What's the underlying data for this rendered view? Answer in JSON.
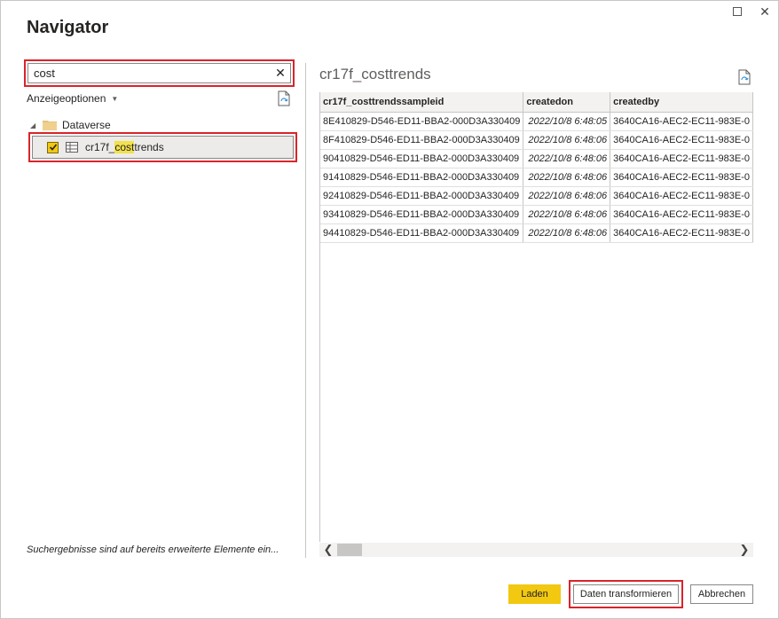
{
  "window": {
    "title": "Navigator",
    "maximize_icon": "maximize-icon",
    "close_icon": "close-icon",
    "close_glyph": "✕"
  },
  "search": {
    "value": "cost",
    "placeholder": "",
    "clear_glyph": "✕"
  },
  "options": {
    "label": "Anzeigeoptionen",
    "caret": "▼"
  },
  "tree": {
    "folder": {
      "label": "Dataverse",
      "expand_glyph": "◢"
    },
    "item": {
      "label_prefix": "cr17f_",
      "label_highlight": "cost",
      "label_suffix": "trends",
      "checked": true
    }
  },
  "left_footer": "Suchergebnisse sind auf bereits erweiterte Elemente ein...",
  "preview": {
    "title": "cr17f_costtrends",
    "columns": [
      "cr17f_costtrendssampleid",
      "createdon",
      "createdby"
    ],
    "rows": [
      [
        "8E410829-D546-ED11-BBA2-000D3A330409",
        "2022/10/8 6:48:05",
        "3640CA16-AEC2-EC11-983E-0"
      ],
      [
        "8F410829-D546-ED11-BBA2-000D3A330409",
        "2022/10/8 6:48:06",
        "3640CA16-AEC2-EC11-983E-0"
      ],
      [
        "90410829-D546-ED11-BBA2-000D3A330409",
        "2022/10/8 6:48:06",
        "3640CA16-AEC2-EC11-983E-0"
      ],
      [
        "91410829-D546-ED11-BBA2-000D3A330409",
        "2022/10/8 6:48:06",
        "3640CA16-AEC2-EC11-983E-0"
      ],
      [
        "92410829-D546-ED11-BBA2-000D3A330409",
        "2022/10/8 6:48:06",
        "3640CA16-AEC2-EC11-983E-0"
      ],
      [
        "93410829-D546-ED11-BBA2-000D3A330409",
        "2022/10/8 6:48:06",
        "3640CA16-AEC2-EC11-983E-0"
      ],
      [
        "94410829-D546-ED11-BBA2-000D3A330409",
        "2022/10/8 6:48:06",
        "3640CA16-AEC2-EC11-983E-0"
      ]
    ],
    "scroll_left": "❮",
    "scroll_right": "❯"
  },
  "buttons": {
    "load": "Laden",
    "transform": "Daten transformieren",
    "cancel": "Abbrechen"
  },
  "colors": {
    "accent": "#f2c811",
    "highlight_border": "#d9242b"
  }
}
